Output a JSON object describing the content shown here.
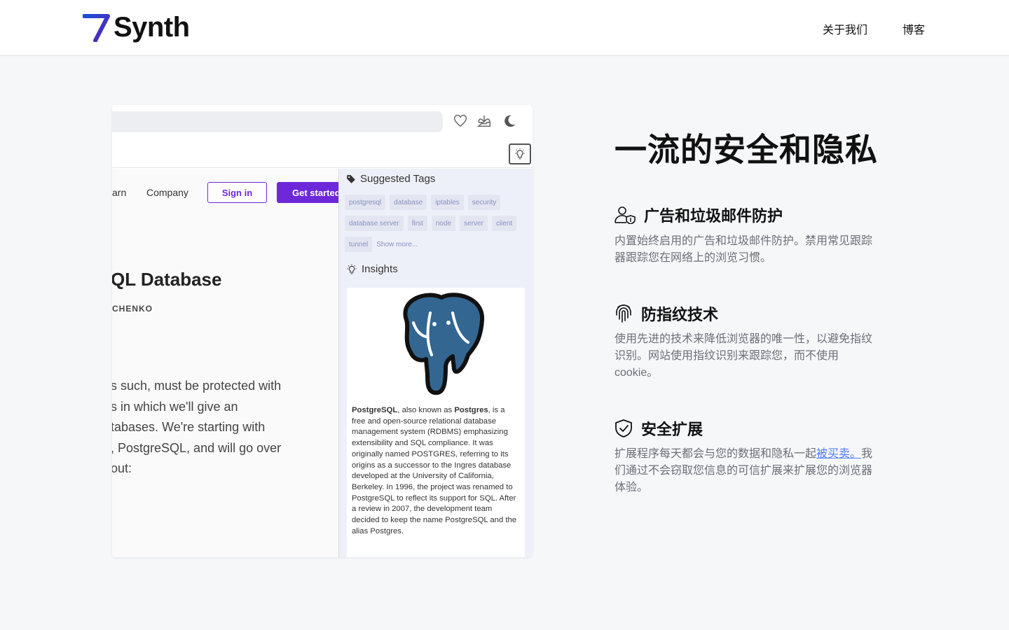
{
  "header": {
    "logo_text": "Synth",
    "nav": [
      {
        "label": "关于我们"
      },
      {
        "label": "博客"
      }
    ]
  },
  "browser_mock": {
    "toolbar_icons": [
      "heart-icon",
      "download-icon",
      "moon-icon"
    ],
    "subbar_icon": "lightbulb-icon",
    "webpage": {
      "nav_learn": "arn",
      "nav_company": "Company",
      "signin_label": "Sign in",
      "getstarted_label": "Get started",
      "title": "QL Database",
      "author": "CHENKO",
      "body_lines": [
        "s such, must be protected with",
        "s in which we'll give an",
        "tabases. We're starting with",
        ", PostgreSQL, and will go over",
        "out:"
      ]
    },
    "panel": {
      "tags_heading": "Suggested Tags",
      "tags": [
        "postgresql",
        "database",
        "iptables",
        "security",
        "database server",
        "first",
        "node",
        "server",
        "client",
        "tunnel"
      ],
      "show_more": "Show more...",
      "insights_heading": "Insights",
      "insight": {
        "b1": "PostgreSQL",
        "t1": ", also known as ",
        "b2": "Postgres",
        "t2": ", is a free and open-source relational database management system (RDBMS) emphasizing extensibility and SQL compliance. It was originally named POSTGRES, referring to its origins as a successor to the Ingres database developed at the University of California, Berkeley. In 1996, the project was renamed to PostgreSQL to reflect its support for SQL. After a review in 2007, the development team decided to keep the name PostgreSQL and the alias Postgres."
      }
    }
  },
  "section": {
    "headline": "一流的安全和隐私",
    "features": [
      {
        "icon": "user-shield-icon",
        "title": "广告和垃圾邮件防护",
        "desc": "内置始终启用的广告和垃圾邮件防护。禁用常见跟踪器跟踪您在网络上的浏览习惯。"
      },
      {
        "icon": "fingerprint-icon",
        "title": "防指纹技术",
        "desc": "使用先进的技术来降低浏览器的唯一性，以避免指纹识别。网站使用指纹识别来跟踪您，而不使用cookie。"
      },
      {
        "icon": "shield-check-icon",
        "title": "安全扩展",
        "desc_before": "扩展程序每天都会与您的数据和隐私一起",
        "desc_link": "被买卖。",
        "desc_after": "我们通过不会窃取您信息的可信扩展来扩展您的浏览器体验。"
      }
    ]
  },
  "colors": {
    "accent_purple": "#6d28d9",
    "logo_blue": "#2b3cf5",
    "link_blue": "#4f7cff",
    "postgres_blue": "#336791"
  }
}
